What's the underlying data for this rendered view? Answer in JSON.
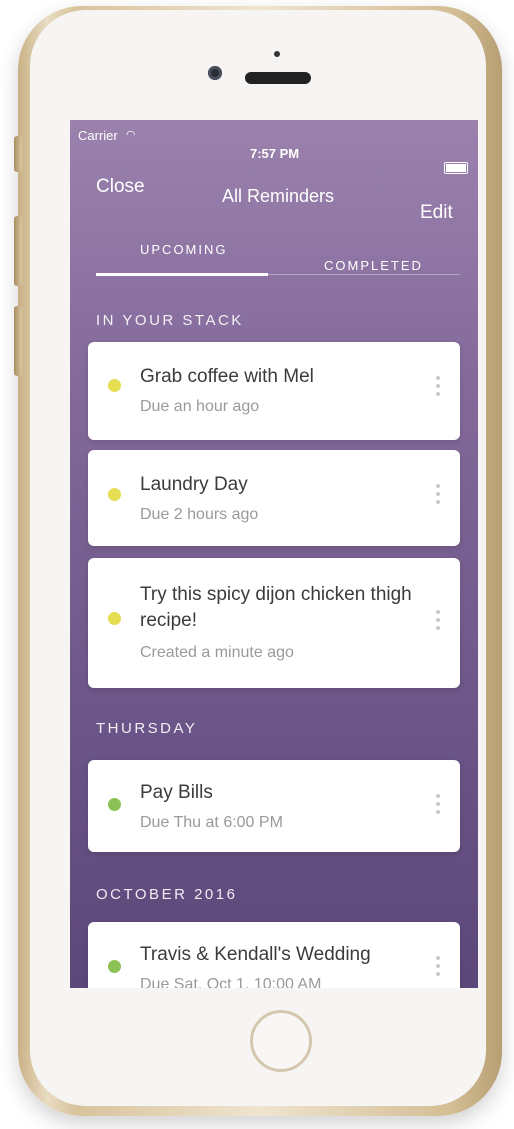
{
  "status_bar": {
    "carrier": "Carrier",
    "time": "7:57 PM"
  },
  "nav": {
    "close": "Close",
    "title": "All Reminders",
    "edit": "Edit"
  },
  "tabs": {
    "upcoming": "UPCOMING",
    "completed": "COMPLETED",
    "active": "upcoming"
  },
  "sections": [
    {
      "title": "IN YOUR STACK",
      "items": [
        {
          "title": "Grab coffee with Mel",
          "sub": "Due an hour ago",
          "dot": "#e6dd52"
        },
        {
          "title": "Laundry Day",
          "sub": "Due 2 hours ago",
          "dot": "#e6dd52"
        },
        {
          "title_line1": "Try this spicy dijon chicken thigh",
          "title_line2": "recipe!",
          "sub": "Created a minute ago",
          "dot": "#e6dd52"
        }
      ]
    },
    {
      "title": "THURSDAY",
      "items": [
        {
          "title": "Pay Bills",
          "sub": "Due Thu at 6:00 PM",
          "dot": "#8cc156"
        }
      ]
    },
    {
      "title": "OCTOBER 2016",
      "items": [
        {
          "title": "Travis & Kendall's Wedding",
          "sub": "Due Sat, Oct 1, 10:00 AM",
          "dot": "#8cc156"
        }
      ]
    }
  ],
  "colors": {
    "accent_purple": "#7d6496",
    "yellow_dot": "#e6dd52",
    "green_dot": "#8cc156"
  }
}
